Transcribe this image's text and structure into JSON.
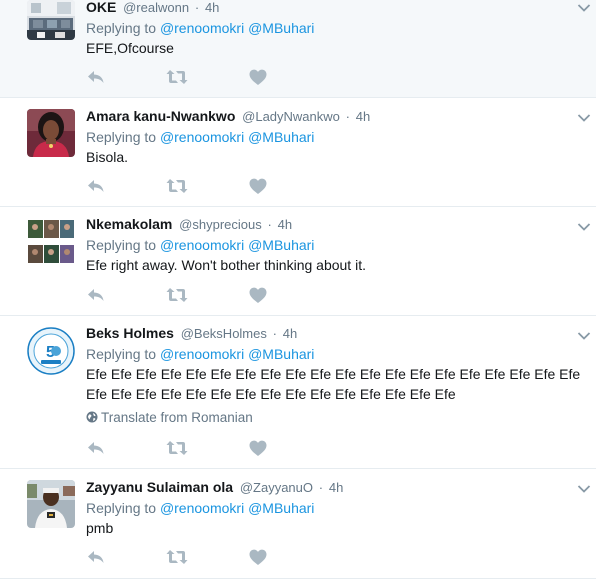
{
  "colors": {
    "link": "#1b95e0",
    "secondary": "#657786",
    "icon": "#aab8c2",
    "border": "#e6ecf0"
  },
  "tweets": [
    {
      "name": "OKE",
      "handle": "@realwonn",
      "time": "4h",
      "replying_prefix": "Replying to",
      "mention1": "@renoomokri",
      "mention2": "@MBuhari",
      "text": "EFE,Ofcourse",
      "translate": "",
      "avatar_icon": "living-room-photo"
    },
    {
      "name": "Amara kanu-Nwankwo",
      "handle": "@LadyNwankwo",
      "time": "4h",
      "replying_prefix": "Replying to",
      "mention1": "@renoomokri",
      "mention2": "@MBuhari",
      "text": "Bisola.",
      "translate": "",
      "avatar_icon": "woman-portrait"
    },
    {
      "name": "Nkemakolam",
      "handle": "@shyprecious",
      "time": "4h",
      "replying_prefix": "Replying to",
      "mention1": "@renoomokri",
      "mention2": "@MBuhari",
      "text": "Efe right away. Won't bother thinking about it.",
      "translate": "",
      "avatar_icon": "collage-photo"
    },
    {
      "name": "Beks Holmes",
      "handle": "@BeksHolmes",
      "time": "4h",
      "replying_prefix": "Replying to",
      "mention1": "@renoomokri",
      "mention2": "@MBuhari",
      "text_line1": "Efe Efe Efe Efe Efe Efe Efe Efe Efe Efe Efe Efe Efe Efe Efe Efe Efe Efe Efe Efe",
      "text_line2": "Efe Efe Efe Efe Efe Efe Efe Efe Efe Efe Efe Efe Efe Efe Efe",
      "translate": "Translate from Romanian",
      "avatar_icon": "anniversary-logo"
    },
    {
      "name": "Zayyanu Sulaiman ola",
      "handle": "@ZayyanuO",
      "time": "4h",
      "replying_prefix": "Replying to",
      "mention1": "@renoomokri",
      "mention2": "@MBuhari",
      "text": "pmb",
      "translate": "",
      "avatar_icon": "man-portrait"
    }
  ]
}
